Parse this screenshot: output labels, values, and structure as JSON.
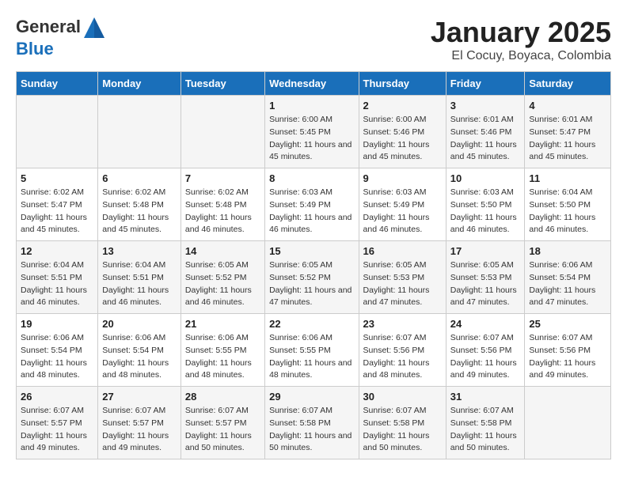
{
  "header": {
    "logo_line1": "General",
    "logo_line2": "Blue",
    "title": "January 2025",
    "subtitle": "El Cocuy, Boyaca, Colombia"
  },
  "days_of_week": [
    "Sunday",
    "Monday",
    "Tuesday",
    "Wednesday",
    "Thursday",
    "Friday",
    "Saturday"
  ],
  "weeks": [
    [
      {
        "num": "",
        "sunrise": "",
        "sunset": "",
        "daylight": ""
      },
      {
        "num": "",
        "sunrise": "",
        "sunset": "",
        "daylight": ""
      },
      {
        "num": "",
        "sunrise": "",
        "sunset": "",
        "daylight": ""
      },
      {
        "num": "1",
        "sunrise": "Sunrise: 6:00 AM",
        "sunset": "Sunset: 5:45 PM",
        "daylight": "Daylight: 11 hours and 45 minutes."
      },
      {
        "num": "2",
        "sunrise": "Sunrise: 6:00 AM",
        "sunset": "Sunset: 5:46 PM",
        "daylight": "Daylight: 11 hours and 45 minutes."
      },
      {
        "num": "3",
        "sunrise": "Sunrise: 6:01 AM",
        "sunset": "Sunset: 5:46 PM",
        "daylight": "Daylight: 11 hours and 45 minutes."
      },
      {
        "num": "4",
        "sunrise": "Sunrise: 6:01 AM",
        "sunset": "Sunset: 5:47 PM",
        "daylight": "Daylight: 11 hours and 45 minutes."
      }
    ],
    [
      {
        "num": "5",
        "sunrise": "Sunrise: 6:02 AM",
        "sunset": "Sunset: 5:47 PM",
        "daylight": "Daylight: 11 hours and 45 minutes."
      },
      {
        "num": "6",
        "sunrise": "Sunrise: 6:02 AM",
        "sunset": "Sunset: 5:48 PM",
        "daylight": "Daylight: 11 hours and 45 minutes."
      },
      {
        "num": "7",
        "sunrise": "Sunrise: 6:02 AM",
        "sunset": "Sunset: 5:48 PM",
        "daylight": "Daylight: 11 hours and 46 minutes."
      },
      {
        "num": "8",
        "sunrise": "Sunrise: 6:03 AM",
        "sunset": "Sunset: 5:49 PM",
        "daylight": "Daylight: 11 hours and 46 minutes."
      },
      {
        "num": "9",
        "sunrise": "Sunrise: 6:03 AM",
        "sunset": "Sunset: 5:49 PM",
        "daylight": "Daylight: 11 hours and 46 minutes."
      },
      {
        "num": "10",
        "sunrise": "Sunrise: 6:03 AM",
        "sunset": "Sunset: 5:50 PM",
        "daylight": "Daylight: 11 hours and 46 minutes."
      },
      {
        "num": "11",
        "sunrise": "Sunrise: 6:04 AM",
        "sunset": "Sunset: 5:50 PM",
        "daylight": "Daylight: 11 hours and 46 minutes."
      }
    ],
    [
      {
        "num": "12",
        "sunrise": "Sunrise: 6:04 AM",
        "sunset": "Sunset: 5:51 PM",
        "daylight": "Daylight: 11 hours and 46 minutes."
      },
      {
        "num": "13",
        "sunrise": "Sunrise: 6:04 AM",
        "sunset": "Sunset: 5:51 PM",
        "daylight": "Daylight: 11 hours and 46 minutes."
      },
      {
        "num": "14",
        "sunrise": "Sunrise: 6:05 AM",
        "sunset": "Sunset: 5:52 PM",
        "daylight": "Daylight: 11 hours and 46 minutes."
      },
      {
        "num": "15",
        "sunrise": "Sunrise: 6:05 AM",
        "sunset": "Sunset: 5:52 PM",
        "daylight": "Daylight: 11 hours and 47 minutes."
      },
      {
        "num": "16",
        "sunrise": "Sunrise: 6:05 AM",
        "sunset": "Sunset: 5:53 PM",
        "daylight": "Daylight: 11 hours and 47 minutes."
      },
      {
        "num": "17",
        "sunrise": "Sunrise: 6:05 AM",
        "sunset": "Sunset: 5:53 PM",
        "daylight": "Daylight: 11 hours and 47 minutes."
      },
      {
        "num": "18",
        "sunrise": "Sunrise: 6:06 AM",
        "sunset": "Sunset: 5:54 PM",
        "daylight": "Daylight: 11 hours and 47 minutes."
      }
    ],
    [
      {
        "num": "19",
        "sunrise": "Sunrise: 6:06 AM",
        "sunset": "Sunset: 5:54 PM",
        "daylight": "Daylight: 11 hours and 48 minutes."
      },
      {
        "num": "20",
        "sunrise": "Sunrise: 6:06 AM",
        "sunset": "Sunset: 5:54 PM",
        "daylight": "Daylight: 11 hours and 48 minutes."
      },
      {
        "num": "21",
        "sunrise": "Sunrise: 6:06 AM",
        "sunset": "Sunset: 5:55 PM",
        "daylight": "Daylight: 11 hours and 48 minutes."
      },
      {
        "num": "22",
        "sunrise": "Sunrise: 6:06 AM",
        "sunset": "Sunset: 5:55 PM",
        "daylight": "Daylight: 11 hours and 48 minutes."
      },
      {
        "num": "23",
        "sunrise": "Sunrise: 6:07 AM",
        "sunset": "Sunset: 5:56 PM",
        "daylight": "Daylight: 11 hours and 48 minutes."
      },
      {
        "num": "24",
        "sunrise": "Sunrise: 6:07 AM",
        "sunset": "Sunset: 5:56 PM",
        "daylight": "Daylight: 11 hours and 49 minutes."
      },
      {
        "num": "25",
        "sunrise": "Sunrise: 6:07 AM",
        "sunset": "Sunset: 5:56 PM",
        "daylight": "Daylight: 11 hours and 49 minutes."
      }
    ],
    [
      {
        "num": "26",
        "sunrise": "Sunrise: 6:07 AM",
        "sunset": "Sunset: 5:57 PM",
        "daylight": "Daylight: 11 hours and 49 minutes."
      },
      {
        "num": "27",
        "sunrise": "Sunrise: 6:07 AM",
        "sunset": "Sunset: 5:57 PM",
        "daylight": "Daylight: 11 hours and 49 minutes."
      },
      {
        "num": "28",
        "sunrise": "Sunrise: 6:07 AM",
        "sunset": "Sunset: 5:57 PM",
        "daylight": "Daylight: 11 hours and 50 minutes."
      },
      {
        "num": "29",
        "sunrise": "Sunrise: 6:07 AM",
        "sunset": "Sunset: 5:58 PM",
        "daylight": "Daylight: 11 hours and 50 minutes."
      },
      {
        "num": "30",
        "sunrise": "Sunrise: 6:07 AM",
        "sunset": "Sunset: 5:58 PM",
        "daylight": "Daylight: 11 hours and 50 minutes."
      },
      {
        "num": "31",
        "sunrise": "Sunrise: 6:07 AM",
        "sunset": "Sunset: 5:58 PM",
        "daylight": "Daylight: 11 hours and 50 minutes."
      },
      {
        "num": "",
        "sunrise": "",
        "sunset": "",
        "daylight": ""
      }
    ]
  ]
}
